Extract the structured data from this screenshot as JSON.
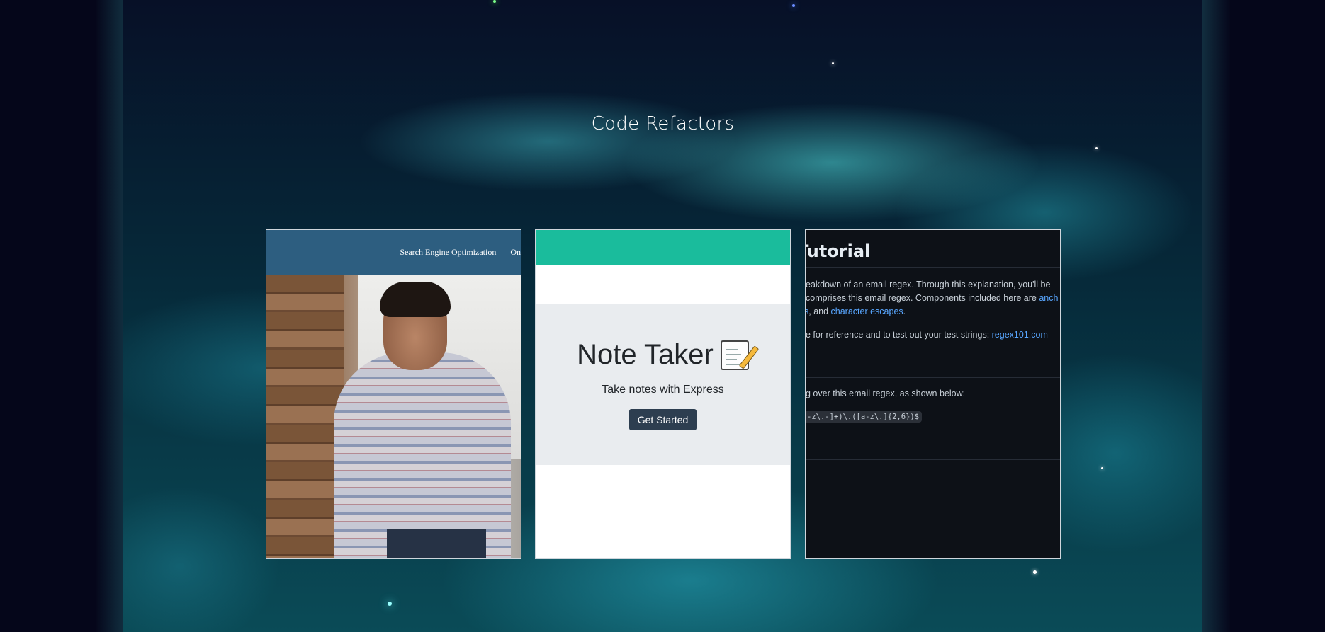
{
  "page": {
    "title": "Code Refactors"
  },
  "cards": {
    "seo": {
      "nav_items": [
        "Search Engine Optimization",
        "On"
      ]
    },
    "note_taker": {
      "title": "Note Taker",
      "subtitle": "Take notes with Express",
      "button_label": "Get Started",
      "accent_color": "#1abc9c",
      "button_color": "#2d3e50"
    },
    "regex_tutorial": {
      "heading": "Tutorial",
      "para1_line1": "eakdown of an email regex. Through this explanation, you'll be",
      "para1_line2_a": "comprises this email regex. Components included here are ",
      "para1_line2_link": "anch",
      "para1_line3_link1": "s",
      "para1_line3_mid": ", and ",
      "para1_line3_link2": "character escapes",
      "para1_line3_end": ".",
      "para2_text": "e for reference and to test out your test strings: ",
      "para2_link": "regex101.com",
      "para3_text": "g over this email regex, as shown below:",
      "code": "-z\\.-]+)\\.([a-z\\.]{2,6})$",
      "link_color": "#58a6ff"
    }
  },
  "colors": {
    "page_bg": "#05061a",
    "seo_nav": "#2d5e80",
    "code_card_bg": "#0d1117"
  }
}
